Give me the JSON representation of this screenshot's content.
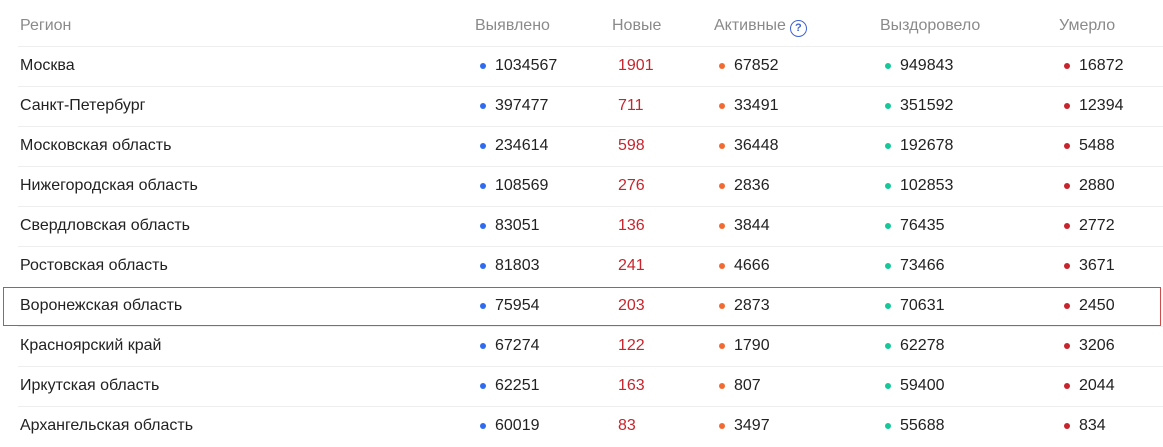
{
  "headers": {
    "region": "Регион",
    "detected": "Выявлено",
    "new": "Новые",
    "active": "Активные",
    "active_help": "?",
    "recovered": "Выздоровело",
    "died": "Умерло"
  },
  "colors": {
    "detected_dot": "#2f6bf0",
    "new_text": "#c8242d",
    "active_dot": "#f26a31",
    "recovered_dot": "#15c89a",
    "died_dot": "#c8242d",
    "highlight_border": "#d14b4b"
  },
  "rows": [
    {
      "region": "Москва",
      "detected": "1034567",
      "new": "1901",
      "active": "67852",
      "recovered": "949843",
      "died": "16872"
    },
    {
      "region": "Санкт-Петербург",
      "detected": "397477",
      "new": "711",
      "active": "33491",
      "recovered": "351592",
      "died": "12394"
    },
    {
      "region": "Московская область",
      "detected": "234614",
      "new": "598",
      "active": "36448",
      "recovered": "192678",
      "died": "5488"
    },
    {
      "region": "Нижегородская область",
      "detected": "108569",
      "new": "276",
      "active": "2836",
      "recovered": "102853",
      "died": "2880"
    },
    {
      "region": "Свердловская область",
      "detected": "83051",
      "new": "136",
      "active": "3844",
      "recovered": "76435",
      "died": "2772"
    },
    {
      "region": "Ростовская область",
      "detected": "81803",
      "new": "241",
      "active": "4666",
      "recovered": "73466",
      "died": "3671"
    },
    {
      "region": "Воронежская область",
      "detected": "75954",
      "new": "203",
      "active": "2873",
      "recovered": "70631",
      "died": "2450",
      "highlighted": true
    },
    {
      "region": "Красноярский край",
      "detected": "67274",
      "new": "122",
      "active": "1790",
      "recovered": "62278",
      "died": "3206"
    },
    {
      "region": "Иркутская область",
      "detected": "62251",
      "new": "163",
      "active": "807",
      "recovered": "59400",
      "died": "2044"
    },
    {
      "region": "Архангельская область",
      "detected": "60019",
      "new": "83",
      "active": "3497",
      "recovered": "55688",
      "died": "834"
    }
  ]
}
